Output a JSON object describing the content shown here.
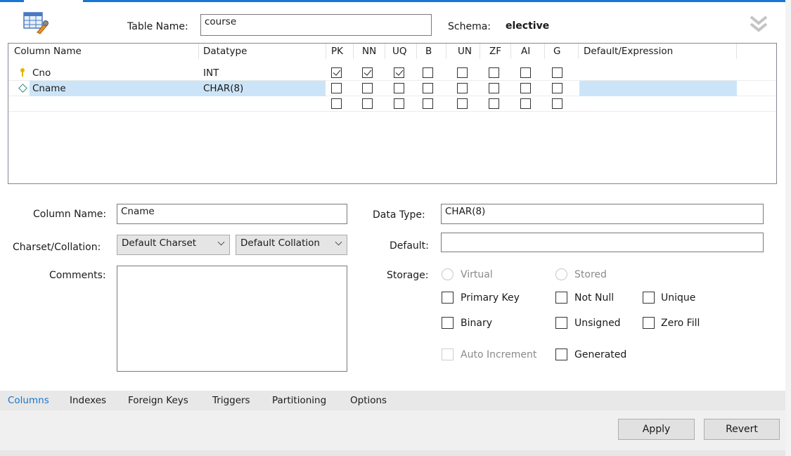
{
  "header": {
    "table_name_label": "Table Name:",
    "table_name_value": "course",
    "schema_label": "Schema:",
    "schema_value": "elective"
  },
  "grid": {
    "columns": [
      "Column Name",
      "Datatype",
      "PK",
      "NN",
      "UQ",
      "B",
      "UN",
      "ZF",
      "AI",
      "G",
      "Default/Expression"
    ],
    "rows": [
      {
        "name": "Cno",
        "type": "INT",
        "key_icon": "primary-key-icon",
        "flags": [
          true,
          true,
          true,
          false,
          false,
          false,
          false,
          false
        ]
      },
      {
        "name": "Cname",
        "type": "CHAR(8)",
        "key_icon": "column-diamond-icon",
        "selected": true,
        "flags": [
          false,
          false,
          false,
          false,
          false,
          false,
          false,
          false
        ]
      },
      {
        "name": "",
        "type": "",
        "flags": [
          false,
          false,
          false,
          false,
          false,
          false,
          false,
          false
        ]
      }
    ]
  },
  "details": {
    "column_name_label": "Column Name:",
    "column_name_value": "Cname",
    "charset_label": "Charset/Collation:",
    "charset_value": "Default Charset",
    "collation_value": "Default Collation",
    "comments_label": "Comments:",
    "data_type_label": "Data Type:",
    "data_type_value": "CHAR(8)",
    "default_label": "Default:",
    "default_value": "",
    "storage_label": "Storage:",
    "virtual_label": "Virtual",
    "stored_label": "Stored",
    "primary_key_label": "Primary Key",
    "not_null_label": "Not Null",
    "unique_label": "Unique",
    "binary_label": "Binary",
    "unsigned_label": "Unsigned",
    "zero_fill_label": "Zero Fill",
    "auto_increment_label": "Auto Increment",
    "generated_label": "Generated"
  },
  "tabs": [
    {
      "label": "Columns",
      "active": true
    },
    {
      "label": "Indexes"
    },
    {
      "label": "Foreign Keys"
    },
    {
      "label": "Triggers"
    },
    {
      "label": "Partitioning"
    },
    {
      "label": "Options"
    }
  ],
  "footer": {
    "apply_label": "Apply",
    "revert_label": "Revert"
  },
  "colors": {
    "accent": "#1976d2",
    "selection": "#cce4f7",
    "active_tab": "#1a73c8"
  }
}
